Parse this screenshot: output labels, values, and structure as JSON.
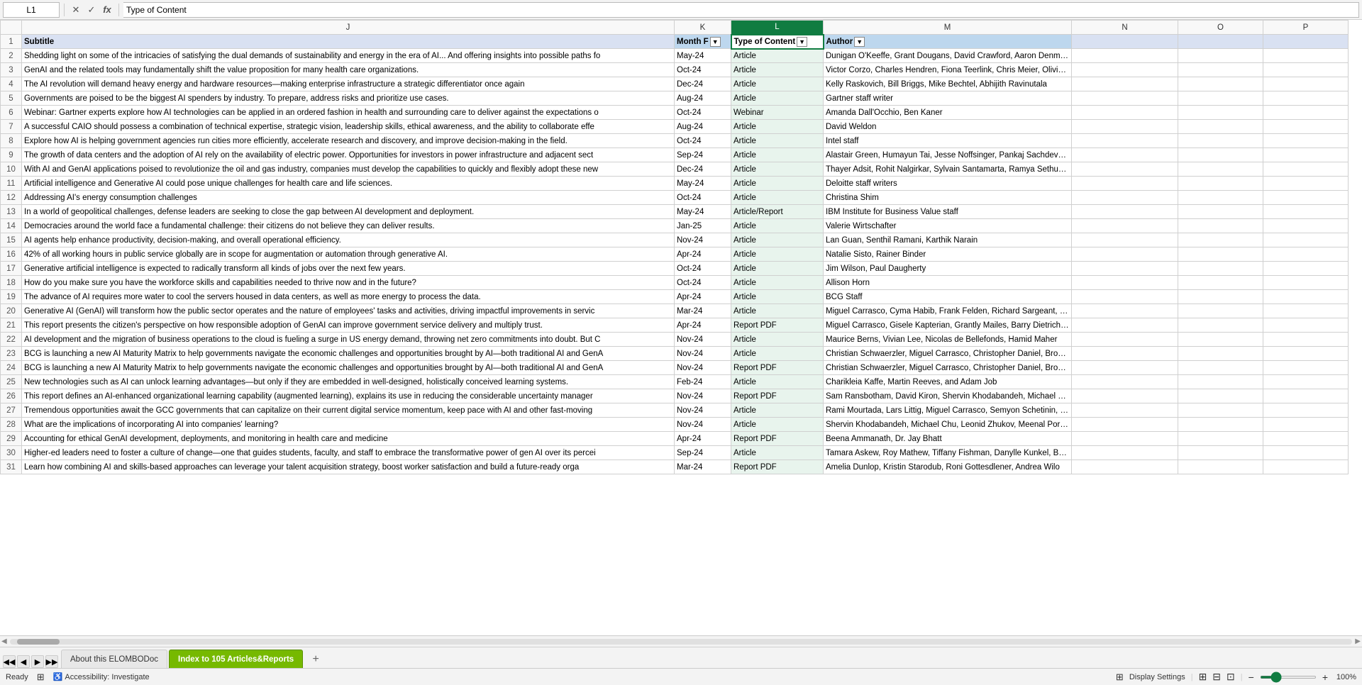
{
  "formulaBar": {
    "nameBox": "L1",
    "cancelLabel": "✕",
    "confirmLabel": "✓",
    "functionLabel": "fx",
    "formula": "Type of Content"
  },
  "statusBar": {
    "ready": "Ready",
    "accessibility": "Accessibility: Investigate",
    "displaySettings": "Display Settings",
    "zoom": "100%"
  },
  "tabs": [
    {
      "label": "About this ELOMBODoc",
      "active": false
    },
    {
      "label": "Index to 105 Articles&Reports",
      "active": true
    }
  ],
  "columns": {
    "rowNum": "#",
    "J": "J",
    "K": "K",
    "L": "L",
    "M": "M",
    "N": "N",
    "O": "O",
    "P": "P"
  },
  "row1": {
    "J": "Subtitle",
    "K": "Month F",
    "L": "Type of Content",
    "M": "Author",
    "N": "",
    "O": "",
    "P": ""
  },
  "rows": [
    {
      "num": 2,
      "J": "Shedding light on some of the intricacies of satisfying the dual demands of sustainability and energy in the era of AI... And offering insights into possible paths fo",
      "K": "May-24",
      "L": "Article",
      "M": "Dunigan O'Keeffe, Grant Dougans, David Crawford, Aaron Denman, An"
    },
    {
      "num": 3,
      "J": "GenAI and the related tools may fundamentally shift the value proposition for many health care organizations.",
      "K": "Oct-24",
      "L": "Article",
      "M": "Victor Corzo,  Charles Hendren, Fiona Teerlink, Chris Meier, Olivia Luz,"
    },
    {
      "num": 4,
      "J": "The AI revolution will demand heavy energy and hardware resources—making enterprise infrastructure a strategic differentiator once again",
      "K": "Dec-24",
      "L": "Article",
      "M": "Kelly Raskovich, Bill Briggs, Mike Bechtel, Abhijith Ravinutala"
    },
    {
      "num": 5,
      "J": "Governments are poised to be the biggest AI spenders by industry. To prepare, address risks and prioritize use cases.",
      "K": "Aug-24",
      "L": "Article",
      "M": "Gartner staff writer"
    },
    {
      "num": 6,
      "J": "Webinar: Gartner experts explore how AI technologies can be applied in an ordered fashion in health and surrounding care to deliver against the expectations o",
      "K": "Oct-24",
      "L": "Webinar",
      "M": "Amanda Dall'Occhio, Ben Kaner"
    },
    {
      "num": 7,
      "J": "A successful CAIO should possess a combination of technical expertise, strategic vision, leadership skills, ethical awareness, and the ability to collaborate effe",
      "K": "Aug-24",
      "L": "Article",
      "M": "David Weldon"
    },
    {
      "num": 8,
      "J": "Explore how AI is helping government agencies run cities more efficiently, accelerate research and discovery, and improve decision-making in the field.",
      "K": "Oct-24",
      "L": "Article",
      "M": "Intel staff"
    },
    {
      "num": 9,
      "J": "The growth of data centers and the adoption of AI rely on the availability of electric power. Opportunities for investors in power infrastructure and adjacent sect",
      "K": "Sep-24",
      "L": "Article",
      "M": "Alastair Green, Humayun Tai, Jesse Noffsinger, Pankaj Sachdeva, Arjit"
    },
    {
      "num": 10,
      "J": "With AI and GenAI applications poised to revolutionize the oil and gas industry, companies must develop the capabilities to quickly and flexibly adopt these new",
      "K": "Dec-24",
      "L": "Article",
      "M": "Thayer Adsit,  Rohit Nalgirkar,  Sylvain Santamarta, Ramya Sethurathina"
    },
    {
      "num": 11,
      "J": "Artificial intelligence and Generative AI could pose unique challenges for health care and life sciences.",
      "K": "May-24",
      "L": "Article",
      "M": "Deloitte staff writers"
    },
    {
      "num": 12,
      "J": "Addressing AI's energy consumption challenges",
      "K": "Oct-24",
      "L": "Article",
      "M": "Christina Shim"
    },
    {
      "num": 13,
      "J": "In a world of geopolitical challenges, defense leaders are seeking to close the gap between AI development and deployment.",
      "K": "May-24",
      "L": "Article/Report",
      "M": "IBM Institute for Business Value staff"
    },
    {
      "num": 14,
      "J": "Democracies around the world face a fundamental challenge: their citizens do not believe they can deliver results.",
      "K": "Jan-25",
      "L": "Article",
      "M": "Valerie Wirtschafter"
    },
    {
      "num": 15,
      "J": "AI agents help enhance productivity, decision-making, and overall operational efficiency.",
      "K": "Nov-24",
      "L": "Article",
      "M": "Lan Guan, Senthil Ramani, Karthik Narain"
    },
    {
      "num": 16,
      "J": "42% of all working hours in public service globally are in scope for augmentation or automation through generative AI.",
      "K": "Apr-24",
      "L": "Article",
      "M": "Natalie Sisto, Rainer Binder"
    },
    {
      "num": 17,
      "J": "Generative artificial intelligence is expected to radically transform all kinds of jobs over the next few years.",
      "K": "Oct-24",
      "L": "Article",
      "M": "Jim Wilson, Paul Daugherty"
    },
    {
      "num": 18,
      "J": "How do you make sure you have the workforce skills and capabilities needed to thrive now and in the future?",
      "K": "Oct-24",
      "L": "Article",
      "M": "Allison Horn"
    },
    {
      "num": 19,
      "J": "The advance of AI requires more water to cool the servers housed in data centers, as well as more energy to process the data.",
      "K": "Apr-24",
      "L": "Article",
      "M": "BCG Staff"
    },
    {
      "num": 20,
      "J": "Generative AI (GenAI) will transform how the public sector operates and the nature of employees' tasks and activities, driving impactful improvements in servic",
      "K": "Mar-24",
      "L": "Article",
      "M": "Miguel Carrasco, Cyma Habib,  Frank Felden,  Richard Sargeant, Steve"
    },
    {
      "num": 21,
      "J": "This report presents the citizen's perspective on how responsible adoption of GenAI can improve government service delivery and multiply trust.",
      "K": "Apr-24",
      "L": "Report PDF",
      "M": "Miguel Carrasco, Gisele Kapterian, Grantly Mailes, Barry Dietrich, and D"
    },
    {
      "num": 22,
      "J": "AI development and the migration of business operations to the cloud is fueling a surge in US energy demand, throwing net zero commitments into doubt. But C",
      "K": "Nov-24",
      "L": "Article",
      "M": "Maurice Berns, Vivian Lee, Nicolas de Bellefonds, Hamid Maher"
    },
    {
      "num": 23,
      "J": "BCG is launching a new AI Maturity Matrix to help governments navigate the economic challenges and opportunities brought by AI—both traditional AI and GenA",
      "K": "Nov-24",
      "L": "Article",
      "M": "Christian Schwaerzler, Miguel Carrasco, Christopher Daniel, Brooke Bo"
    },
    {
      "num": 24,
      "J": "BCG is launching a new AI Maturity Matrix to help governments navigate the economic challenges and opportunities brought by AI—both traditional AI and GenA",
      "K": "Nov-24",
      "L": "Report PDF",
      "M": "Christian Schwaerzler, Miguel Carrasco, Christopher Daniel, Brooke B"
    },
    {
      "num": 25,
      "J": "New technologies such as AI can unlock learning advantages—but only if they are embedded in well-designed, holistically conceived learning systems.",
      "K": "Feb-24",
      "L": "Article",
      "M": "Charikleia Kaffe,  Martin Reeves, and Adam Job"
    },
    {
      "num": 26,
      "J": "This report defines an AI-enhanced organizational learning capability (augmented learning), explains its use in reducing the considerable uncertainty manager",
      "K": "Nov-24",
      "L": "Report PDF",
      "M": "Sam Ransbotham, David Kiron,  Shervin Khodabandeh, Michael Chu,  a"
    },
    {
      "num": 27,
      "J": "Tremendous opportunities await the GCC governments that can capitalize on their current digital service momentum, keep pace with AI and other fast-moving",
      "K": "Nov-24",
      "L": "Article",
      "M": "Rami Mourtada,  Lars Littig,  Miguel Carrasco, Semyon Schetinin, and A"
    },
    {
      "num": 28,
      "J": "What are the implications of incorporating AI into companies' learning?",
      "K": "Nov-24",
      "L": "Article",
      "M": "Shervin Khodabandeh, Michael Chu, Leonid Zhukov, Meenal Pore, Nam"
    },
    {
      "num": 29,
      "J": "Accounting for ethical GenAI development, deployments, and monitoring in health care and medicine",
      "K": "Apr-24",
      "L": "Report PDF",
      "M": "Beena Ammanath, Dr. Jay Bhatt"
    },
    {
      "num": 30,
      "J": "Higher-ed leaders need to foster a culture of change—one that guides students, faculty, and staff to embrace the transformative power of gen AI over its percei",
      "K": "Sep-24",
      "L": "Article",
      "M": "Tamara Askew, Roy Mathew, Tiffany Fishman, Danylle Kunkel, Bob Care"
    },
    {
      "num": 31,
      "J": "Learn how combining AI and skills-based approaches can leverage your talent acquisition strategy, boost worker satisfaction and build a future-ready orga",
      "K": "Mar-24",
      "L": "Report PDF",
      "M": "Amelia Dunlop, Kristin Starodub, Roni Gottesdlener, Andrea Wilo"
    }
  ]
}
